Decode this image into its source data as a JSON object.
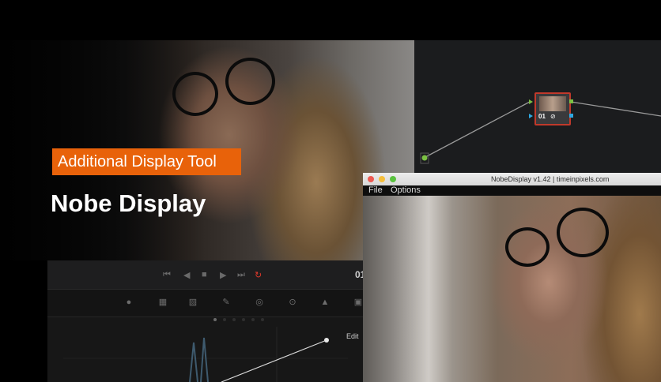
{
  "banner": {
    "badge": "Additional Display Tool",
    "title": "Nobe Display"
  },
  "viewer": {
    "timecode_partial": "01"
  },
  "nodegraph": {
    "node_label": "01"
  },
  "scopes": {
    "edit_label": "Edit"
  },
  "window": {
    "title": "NobeDisplay v1.42 | timeinpixels.com",
    "menu": [
      "File",
      "Options"
    ]
  },
  "colors": {
    "accent": "#e8620a",
    "node_border": "#c0392b",
    "loop": "#e0392b"
  },
  "icons": [
    "skip-back-icon",
    "play-reverse-icon",
    "stop-icon",
    "play-icon",
    "skip-forward-icon",
    "loop-icon",
    "picker-icon",
    "window-icon",
    "tracker-icon",
    "key-icon",
    "sizing-icon"
  ]
}
